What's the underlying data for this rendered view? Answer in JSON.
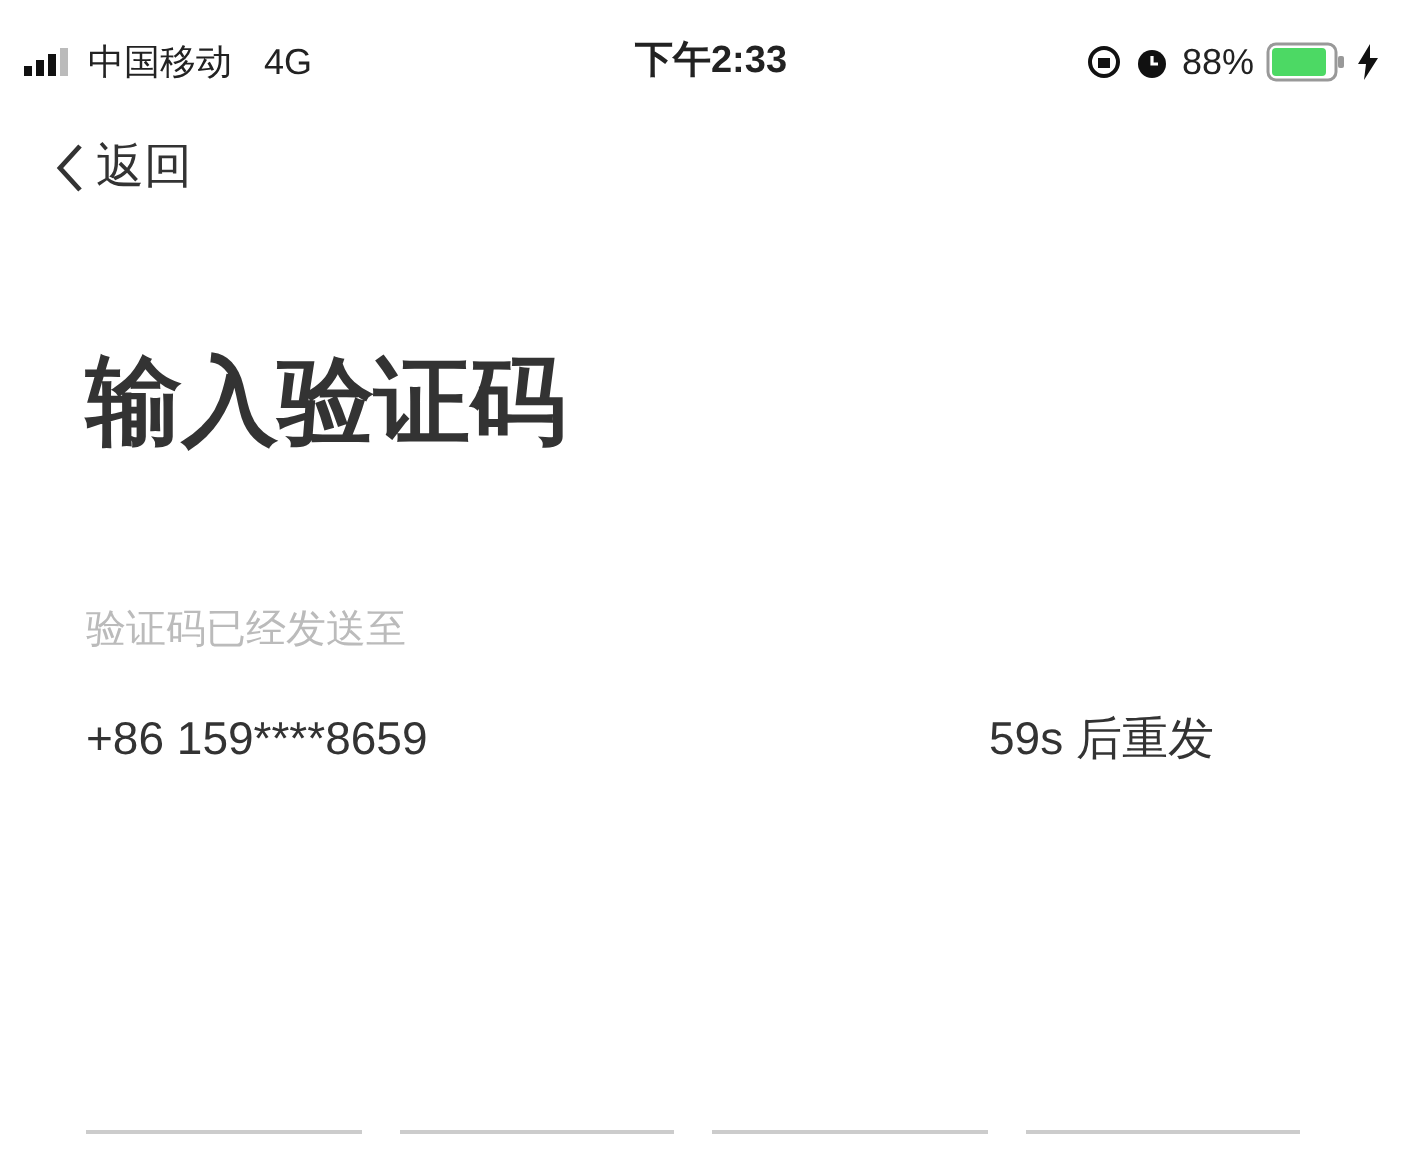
{
  "status_bar": {
    "carrier": "中国移动",
    "network": "4G",
    "time": "下午2:33",
    "battery": "88%"
  },
  "nav": {
    "back": "返回"
  },
  "title": "输入验证码",
  "subtitle": "验证码已经发送至",
  "phone": "+86 159****8659",
  "resend": "59s 后重发",
  "code_fields": [
    {
      "focused": false
    },
    {
      "focused": false
    },
    {
      "focused": false
    },
    {
      "focused": false
    }
  ]
}
